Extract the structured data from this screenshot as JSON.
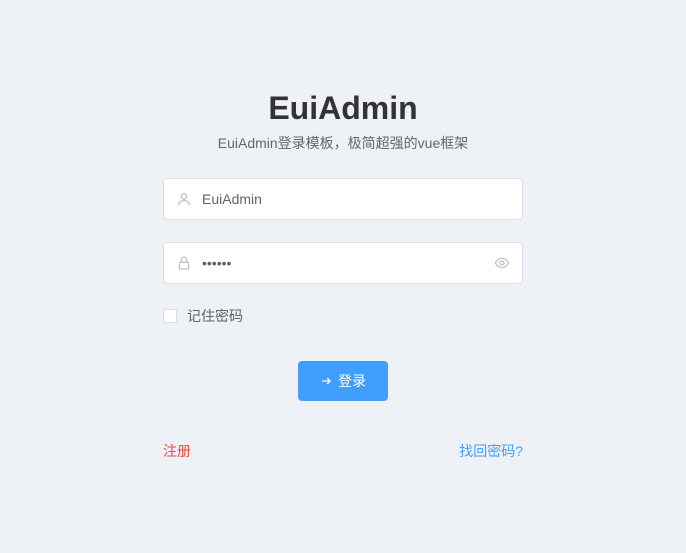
{
  "header": {
    "title": "EuiAdmin",
    "subtitle": "EuiAdmin登录模板，极简超强的vue框架"
  },
  "form": {
    "username": {
      "value": "EuiAdmin",
      "placeholder": ""
    },
    "password": {
      "value": "••••••",
      "placeholder": ""
    },
    "remember": {
      "label": "记住密码",
      "checked": false
    },
    "login_button": "登录"
  },
  "links": {
    "register": "注册",
    "forgot": "找回密码?"
  }
}
